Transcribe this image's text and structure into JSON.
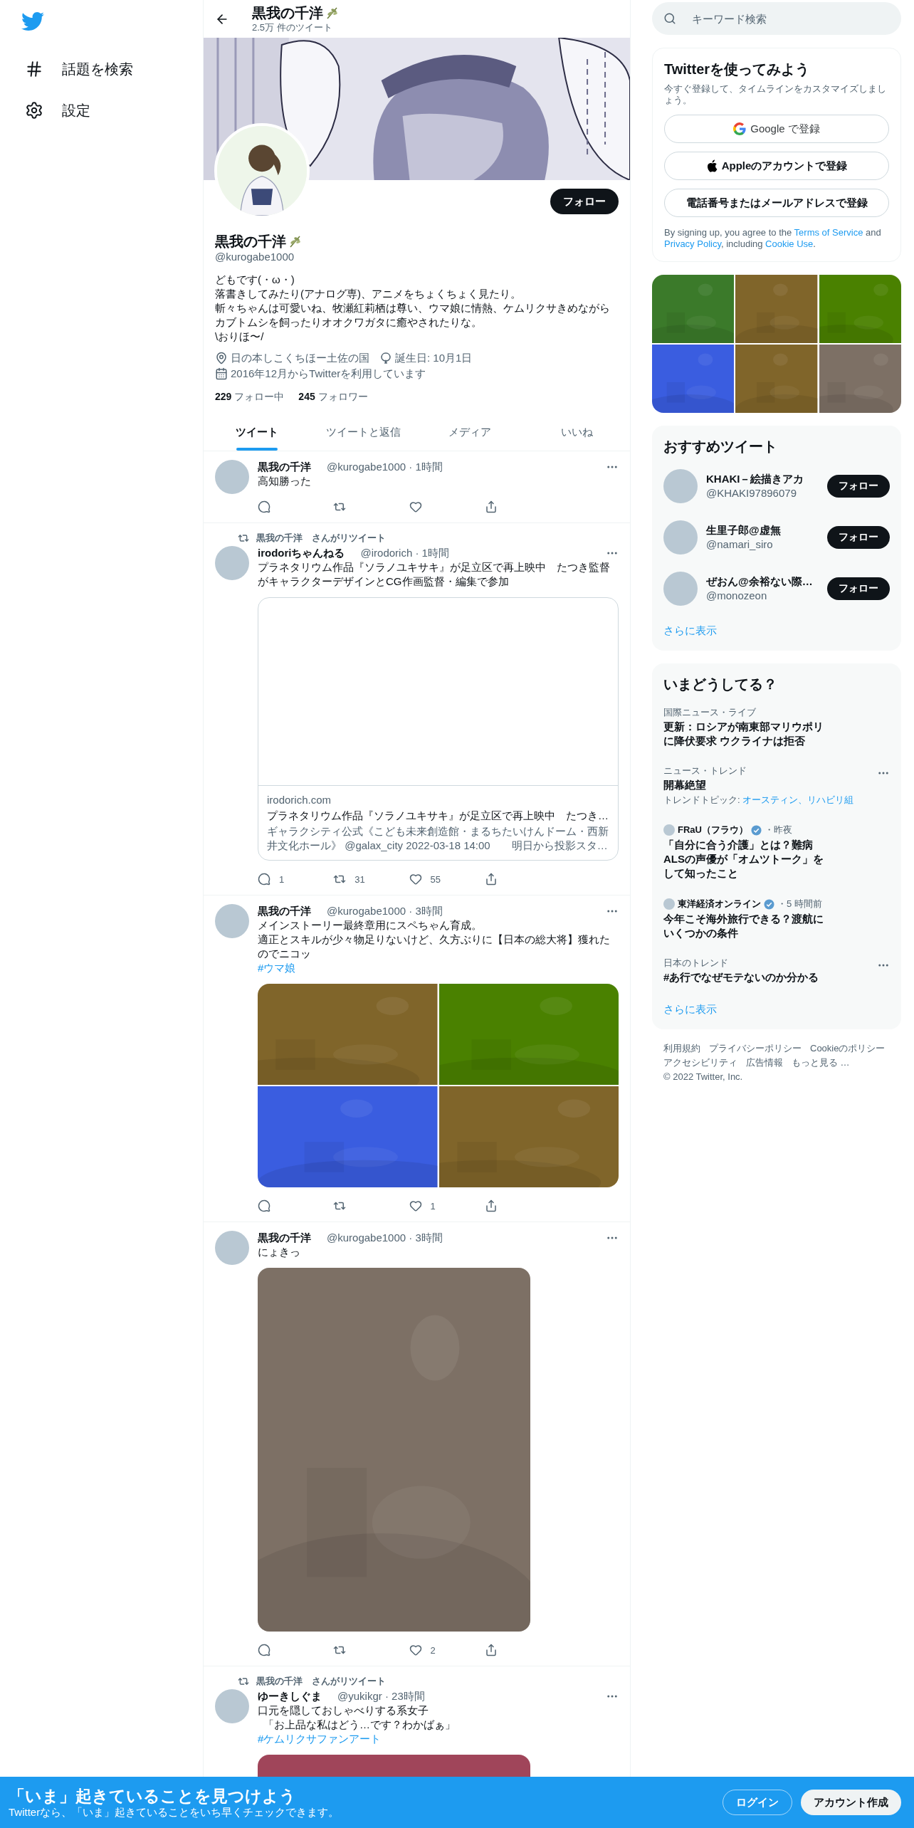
{
  "nav": {
    "items": [
      {
        "label": "話題を検索"
      },
      {
        "label": "設定"
      }
    ]
  },
  "header": {
    "name": "黒我の千洋",
    "tweet_count": "2.5万 件のツイート"
  },
  "profile": {
    "follow_button": "フォロー",
    "name": "黒我の千洋",
    "handle": "@kurogabe1000",
    "bio": [
      "どもです(・ω・)",
      "落書きしてみたり(アナログ専)、アニメをちょくちょく見たり。",
      "斬々ちゃんは可愛いね、牧瀬紅莉栖は尊い、ウマ娘に情熱、ケムリクサきめながらカブトムシを飼ったりオオクワガタに癒やされたりな。",
      "\\おりほ〜/"
    ],
    "meta": [
      {
        "kind": "location",
        "text": "日の本しこくちほー土佐の国"
      },
      {
        "kind": "birthday",
        "text": "誕生日: 10月1日"
      },
      {
        "kind": "joined",
        "text": "2016年12月からTwitterを利用しています"
      }
    ],
    "stats": [
      {
        "count": "229",
        "label": "フォロー中"
      },
      {
        "count": "245",
        "label": "フォロワー"
      }
    ]
  },
  "tabs": [
    {
      "label": "ツイート",
      "selected": true
    },
    {
      "label": "ツイートと返信",
      "selected": false
    },
    {
      "label": "メディア",
      "selected": false
    },
    {
      "label": "いいね",
      "selected": false
    }
  ],
  "tweets": [
    {
      "name": "黒我の千洋",
      "meta": "@kurogabe1000 · 1時間",
      "text": [
        "高知勝った"
      ]
    },
    {
      "retweeted_by": "黒我の千洋　さんがリツイート",
      "name": "irodoriちゃんねる",
      "meta": "@irodorich · 1時間",
      "text": [
        "プラネタリウム作品『ソラノユキサキ』が足立区で再上映中　たつき監督がキャラクターデザインとCG作画監督・編集で参加"
      ],
      "card": {
        "domain": "irodorich.com",
        "title": "プラネタリウム作品『ソラノユキサキ』が足立区で再上映中　たつき…",
        "description": "ギャラクシティ公式《こども未来創造館・まるちたいけんドーム・西新井文化ホール》 @galax_city 2022-03-18 14:00　　明日から投影スタ…"
      },
      "stats": {
        "reply": "1",
        "retweet": "31",
        "like": "55"
      }
    },
    {
      "name": "黒我の千洋",
      "meta": "@kurogabe1000 · 3時間",
      "text": [
        "メインストーリー最終章用にスペちゃん育成。",
        "適正とスキルが少々物足りないけど、久方ぶりに【日本の総大将】獲れたのでニコッ"
      ],
      "hashtag": "#ウマ娘",
      "media": [
        {
          "kind": "picture"
        },
        {
          "kind": "picture"
        },
        {
          "kind": "picture"
        },
        {
          "kind": "picture"
        }
      ],
      "stats": {
        "like": "1"
      }
    },
    {
      "name": "黒我の千洋",
      "meta": "@kurogabe1000 · 3時間",
      "text": [
        "にょきっ"
      ],
      "media": [
        {
          "kind": "picture"
        }
      ],
      "stats": {
        "like": "2"
      }
    },
    {
      "retweeted_by": "黒我の千洋　さんがリツイート",
      "name": "ゆーきしぐま",
      "meta": "@yukikgr · 23時間",
      "text": [
        "口元を隠しておしゃべりする系女子",
        "「お上品な私はどう…です？わかばぁ」"
      ],
      "hashtag": "#ケムリクサファンアート",
      "media": [
        {
          "kind": "picture"
        }
      ]
    }
  ],
  "search": {
    "placeholder": "キーワード検索"
  },
  "signup": {
    "title": "Twitterを使ってみよう",
    "subtitle": "今すぐ登録して、タイムラインをカスタマイズしましょう。",
    "buttons": [
      {
        "kind": "google",
        "label": "Google で登録"
      },
      {
        "kind": "apple",
        "label": "Appleのアカウントで登録"
      },
      {
        "kind": "phone",
        "label": "電話番号またはメールアドレスで登録"
      }
    ],
    "legal": [
      {
        "kind": "text",
        "text": "By signing up, you agree to the "
      },
      {
        "kind": "link",
        "text": "Terms of Service"
      },
      {
        "kind": "text",
        "text": " and "
      },
      {
        "kind": "link",
        "text": "Privacy Policy"
      },
      {
        "kind": "text",
        "text": ", including "
      },
      {
        "kind": "link",
        "text": "Cookie Use"
      },
      {
        "kind": "text",
        "text": "."
      }
    ]
  },
  "media_grid": [
    {
      "kind": "picture"
    },
    {
      "kind": "picture"
    },
    {
      "kind": "picture"
    },
    {
      "kind": "picture"
    },
    {
      "kind": "picture"
    },
    {
      "kind": "picture"
    }
  ],
  "recommended": {
    "title": "おすすめツイート",
    "users": [
      {
        "name": "KHAKI－絵描きアカ",
        "handle": "@KHAKI97896079",
        "button": "フォロー"
      },
      {
        "name": "生里子郎@虚無",
        "handle": "@namari_siro",
        "button": "フォロー"
      },
      {
        "name": "ぜおん@余裕ない際…",
        "handle": "@monozeon",
        "button": "フォロー"
      }
    ],
    "more": "さらに表示"
  },
  "trends": {
    "title": "いまどうしてる？",
    "items": [
      {
        "kind": "news",
        "context": "国際ニュース・ライブ",
        "title": "更新：ロシアが南東部マリウポリに降伏要求 ウクライナは拒否"
      },
      {
        "kind": "trend",
        "context": "ニュース・トレンド",
        "title": "開幕絶望",
        "topics_label": "トレンドトピック: ",
        "topics": "オースティン、リハビリ組"
      },
      {
        "kind": "article",
        "source": "FRaU（フラウ）",
        "verified": true,
        "time": "・昨夜",
        "title": "「自分に合う介護」とは？難病ALSの声優が「オムツトーク」をして知ったこと"
      },
      {
        "kind": "article",
        "source": "東洋経済オンライン",
        "verified": true,
        "time": "・5 時間前",
        "title": "今年こそ海外旅行できる？渡航にいくつかの条件"
      },
      {
        "kind": "trend",
        "context": "日本のトレンド",
        "title": "#あ行でなぜモテないのか分かる"
      }
    ],
    "more": "さらに表示"
  },
  "footer": {
    "links": [
      "利用規約",
      "プライバシーポリシー",
      "Cookieのポリシー",
      "アクセシビリティ",
      "広告情報",
      "もっと見る …"
    ],
    "copyright": "© 2022 Twitter, Inc."
  },
  "bottom_bar": {
    "title": "「いま」起きていることを見つけよう",
    "subtitle": "Twitterなら、「いま」起きていることをいち早くチェックできます。",
    "login": "ログイン",
    "signup": "アカウント作成"
  }
}
